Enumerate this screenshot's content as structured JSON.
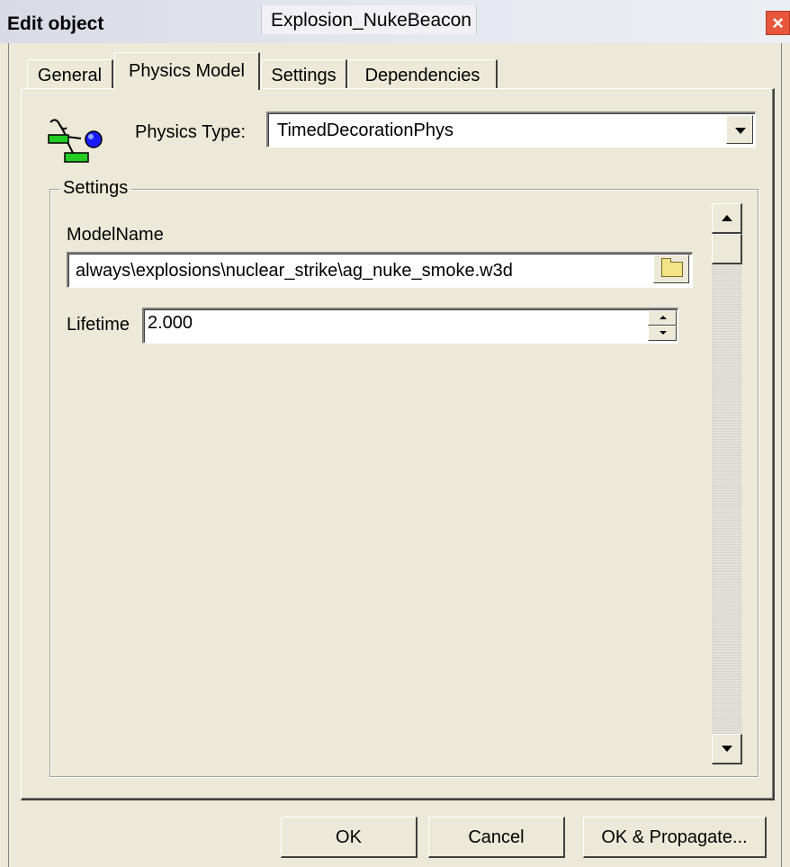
{
  "window": {
    "title": "Edit object",
    "object_name": "Explosion_NukeBeacon",
    "close_glyph": "×"
  },
  "tabs": [
    {
      "label": "General"
    },
    {
      "label": "Physics Model"
    },
    {
      "label": "Settings"
    },
    {
      "label": "Dependencies"
    }
  ],
  "physics": {
    "type_label": "Physics Type:",
    "type_value": "TimedDecorationPhys",
    "icon": "physics-model-icon"
  },
  "settings_group": {
    "title": "Settings",
    "model_name_label": "ModelName",
    "model_name_value": "always\\explosions\\nuclear_strike\\ag_nuke_smoke.w3d",
    "lifetime_label": "Lifetime",
    "lifetime_value": "2.000"
  },
  "buttons": {
    "ok": "OK",
    "cancel": "Cancel",
    "ok_propagate": "OK & Propagate..."
  },
  "colors": {
    "dialog_bg": "#ece9d8",
    "close_red": "#e8563b",
    "icon_green": "#22cc22",
    "icon_blue": "#1a1aff"
  }
}
